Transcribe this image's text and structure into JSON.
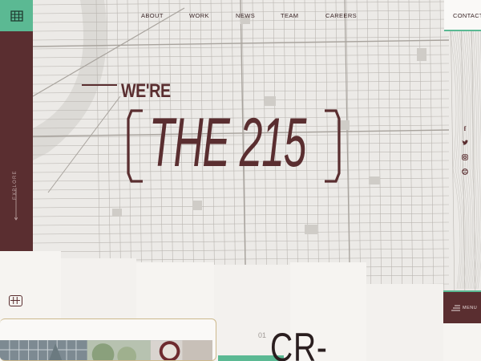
{
  "nav": {
    "items": [
      "ABOUT",
      "WORK",
      "NEWS",
      "TEAM",
      "CAREERS"
    ],
    "contact": "CONTACT"
  },
  "sidebar": {
    "label": "EXPLORE"
  },
  "hero": {
    "intro": "WE'RE",
    "headline": "THE 215"
  },
  "social": [
    "facebook-icon",
    "twitter-icon",
    "instagram-icon",
    "dribbble-icon"
  ],
  "menu": {
    "label": "MENU"
  },
  "section": {
    "number": "01",
    "title": "CR-"
  },
  "colors": {
    "maroon": "#5a2e30",
    "green": "#5bb993",
    "paper": "#f6f4f1"
  }
}
